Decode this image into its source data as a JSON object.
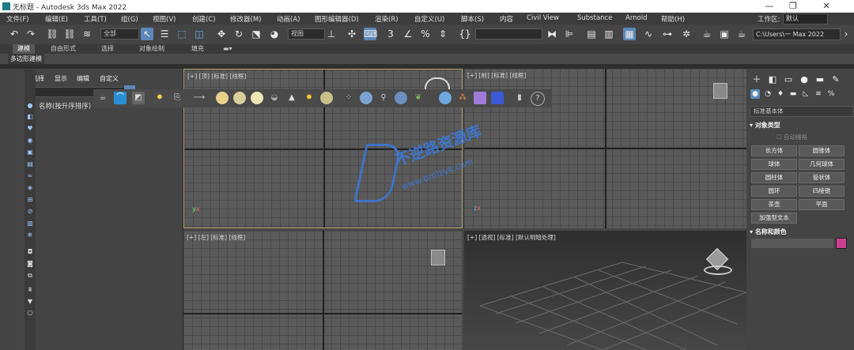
{
  "titlebar": {
    "title": "无标题 - Autodesk 3ds Max 2022",
    "minimize": "—",
    "maximize": "❐",
    "close": "✕"
  },
  "menubar": {
    "items": [
      "文件(F)",
      "编辑(E)",
      "工具(T)",
      "组(G)",
      "视图(V)",
      "创建(C)",
      "修改器(M)",
      "动画(A)",
      "图形编辑器(D)",
      "渲染(R)",
      "自定义(U)",
      "脚本(S)",
      "内容",
      "Civil View",
      "Substance",
      "Arnold",
      "帮助(H)"
    ],
    "workspace_label": "工作区:",
    "workspace_value": "默认"
  },
  "toolbar": {
    "selection_filter": "全部",
    "ref_coord": "视图",
    "named_selection": "",
    "path": "C:\\Users\\一 Max 2022"
  },
  "ribbon": {
    "tabs": [
      "建模",
      "自由形式",
      "选择",
      "对象绘制",
      "填充"
    ],
    "panel_label": "多边形建模"
  },
  "explorer": {
    "menus": [
      "选择",
      "显示",
      "编辑",
      "自定义"
    ],
    "column_header": "名称(按升序排序)"
  },
  "viewports": {
    "top_left": "[+] [顶] [标准] [线框]",
    "top_right": "[+] [前] [标准] [线框]",
    "bottom_left": "[+] [左] [标准] [线框]",
    "bottom_right": "[+] [透视] [标准] [默认明暗处理]"
  },
  "command_panel": {
    "category": "标准基本体",
    "object_type_title": "对象类型",
    "autogrid": "自动栅格",
    "buttons": [
      "长方体",
      "圆锥体",
      "球体",
      "几何球体",
      "圆柱体",
      "管状体",
      "圆环",
      "四棱锥",
      "茶壶",
      "平面",
      "加强型文本"
    ],
    "name_color_title": "名称和颜色",
    "swatch_color": "#cc3d92"
  },
  "watermark": {
    "line1": "不逆路资源库",
    "line2": "www.bmlzyk.com"
  },
  "colors": {
    "accent": "#5b88b8",
    "active_viewport_border": "#b5a36a"
  }
}
